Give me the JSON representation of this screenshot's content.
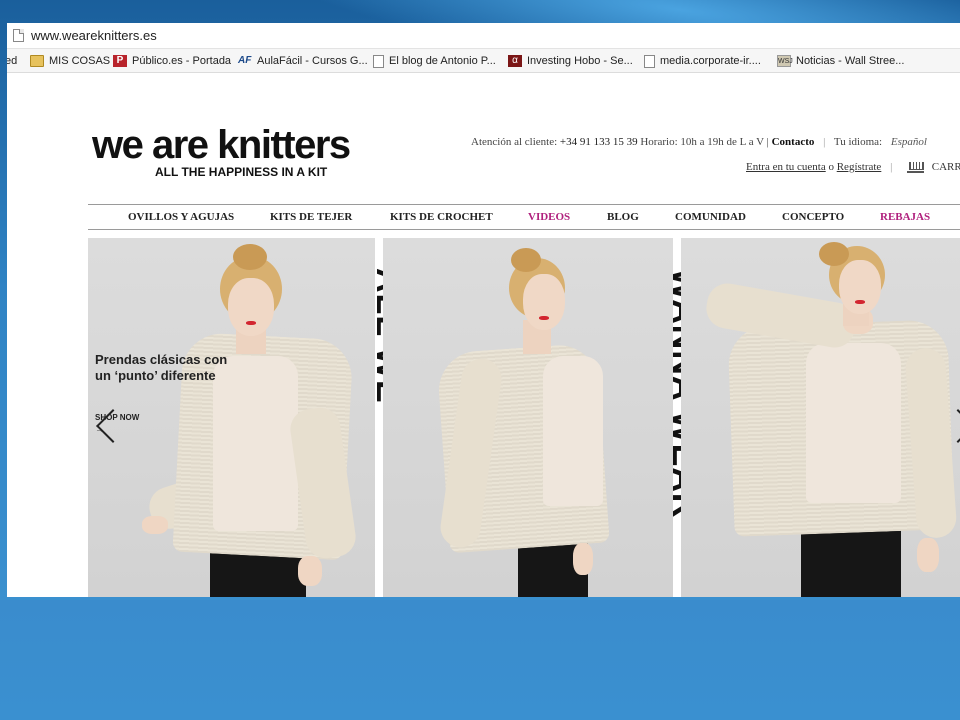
{
  "browser": {
    "url": "www.weareknitters.es",
    "bookmarks": [
      {
        "label": "ed",
        "icon": "none"
      },
      {
        "label": "MIS COSAS",
        "icon": "folder-icon"
      },
      {
        "label": "Público.es - Portada",
        "icon": "publico-icon"
      },
      {
        "label": "AulaFácil - Cursos G...",
        "icon": "aulafacil-icon"
      },
      {
        "label": "El blog de Antonio P...",
        "icon": "document-icon"
      },
      {
        "label": "Investing Hobo - Se...",
        "icon": "alpha-icon"
      },
      {
        "label": "media.corporate-ir....",
        "icon": "document-icon"
      },
      {
        "label": "Noticias - Wall Stree...",
        "icon": "wsj-icon"
      }
    ]
  },
  "site": {
    "logo": "we are knitters",
    "tagline": "ALL THE HAPPINESS IN A KIT",
    "topinfo": {
      "attention": "Atención al cliente:",
      "phone": "+34 91 133 15 39",
      "hours": "Horario: 10h a 19h de L a V |",
      "contact": "Contacto",
      "lang_label": "Tu idioma:",
      "lang": "Español"
    },
    "account": {
      "login": "Entra en tu cuenta",
      "or": "o",
      "register": "Regístrate",
      "cart": "CARRIT"
    },
    "nav": [
      {
        "label": "OVILLOS Y AGUJAS",
        "highlight": false
      },
      {
        "label": "KITS DE TEJER",
        "highlight": false
      },
      {
        "label": "KITS DE CROCHET",
        "highlight": false
      },
      {
        "label": "VIDEOS",
        "highlight": true
      },
      {
        "label": "BLOG",
        "highlight": false
      },
      {
        "label": "COMUNIDAD",
        "highlight": false
      },
      {
        "label": "CONCEPTO",
        "highlight": false
      },
      {
        "label": "REBAJAS",
        "highlight": true
      }
    ],
    "hero": {
      "headline": "Prendas clásicas con un ‘punto’ diferente",
      "shop_now": "SHOP NOW",
      "vertical_text_1": "ALL WE",
      "vertical_text_2": "WANNA WEAR"
    },
    "colors": {
      "accent_pink": "#b0207d",
      "slide_blue": "#2f83c4"
    }
  }
}
